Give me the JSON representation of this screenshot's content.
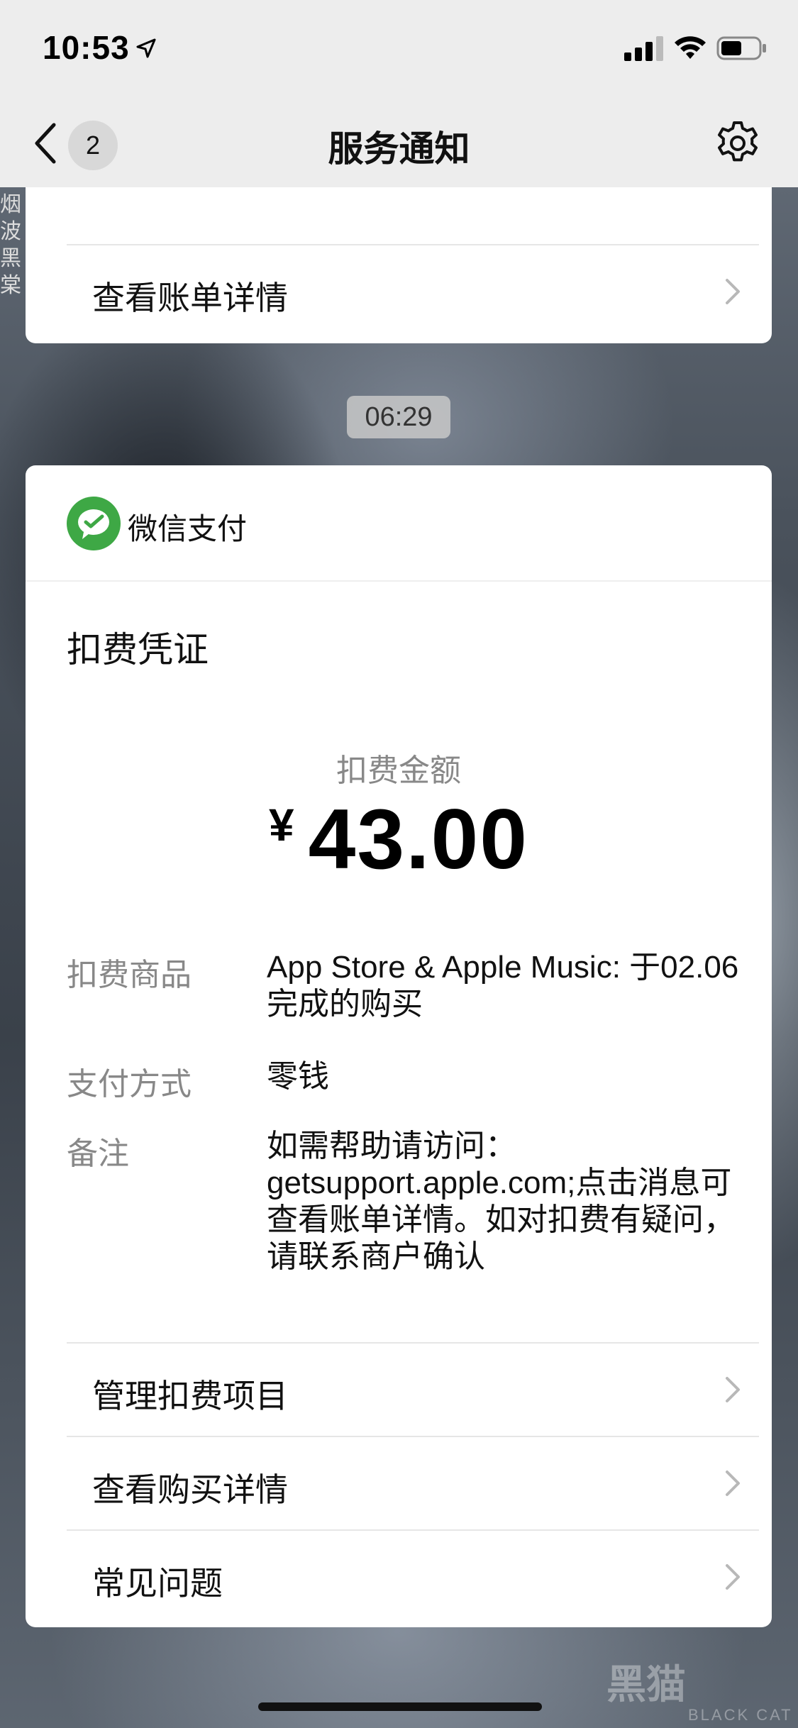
{
  "status_bar": {
    "time": "10:53"
  },
  "nav": {
    "back_badge": "2",
    "title": "服务通知"
  },
  "prev_card": {
    "link_label": "查看账单详情"
  },
  "message_time": "06:29",
  "receipt": {
    "payment_brand": "微信支付",
    "title": "扣费凭证",
    "amount_label": "扣费金额",
    "currency": "¥",
    "amount": "43.00",
    "fields": [
      {
        "key": "扣费商品",
        "value": "App Store & Apple Music: 于02.06完成的购买"
      },
      {
        "key": "支付方式",
        "value": "零钱"
      },
      {
        "key": "备注",
        "value": "如需帮助请访问：getsupport.apple.com;点击消息可查看账单详情。如对扣费有疑问，请联系商户确认"
      }
    ],
    "links": [
      "管理扣费项目",
      "查看购买详情",
      "常见问题"
    ]
  },
  "background_side_text": "烟\n波\n黑\n棠",
  "watermark": {
    "title": "黑猫",
    "sub": "BLACK CAT"
  },
  "colors": {
    "wechat_green": "#3ea845",
    "nav_bg": "#ededed"
  }
}
